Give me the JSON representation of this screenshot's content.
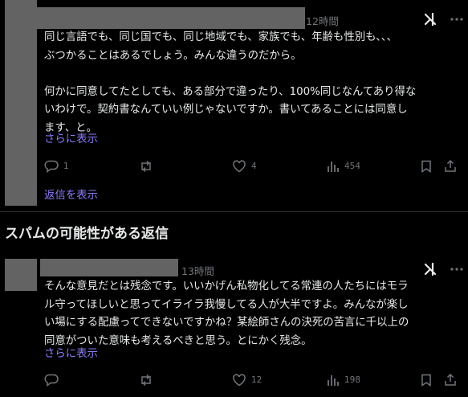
{
  "post1": {
    "time": "12時間",
    "body": "同じ言語でも、同じ国でも、同じ地域でも、家族でも、年齢も性別も、、、\nぶつかることはあるでしょう。みんな違うのだから。\n\n何かに同意してたとしても、ある部分で違ったり、100%同じなんてあり得な\nいわけで。契約書なんていい例じゃないですか。書いてあることには同意し\nます、と。",
    "show_more": "さらに表示",
    "replies": "1",
    "likes": "4",
    "views": "454",
    "show_replies": "返信を表示"
  },
  "section": {
    "title": "スパムの可能性がある返信"
  },
  "post2": {
    "time": "13時間",
    "body": "そんな意見だとは残念です。いいかげん私物化してる常連の人たちにはモラ\nル守ってほしいと思ってイライラ我慢してる人が大半ですよ。みんなが楽し\nい場にする配慮ってできないですかね？某絵師さんの決死の苦言に千以上の\n同意がついた意味も考えるべきと思う。とにかく残念。",
    "show_more": "さらに表示",
    "replies": "",
    "likes": "12",
    "views": "198"
  },
  "icons": {
    "grok": "grok-icon",
    "reply": "reply-icon",
    "repost": "repost-icon",
    "like": "heart-icon",
    "views": "views-icon",
    "bookmark": "bookmark-icon",
    "share": "share-icon"
  }
}
